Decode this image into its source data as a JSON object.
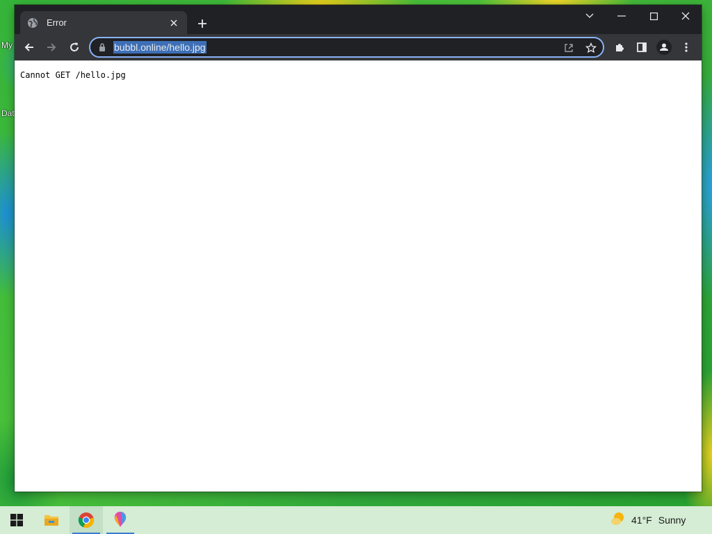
{
  "desktop": {
    "icon_label_1": "My",
    "icon_label_2": "Dat"
  },
  "browser": {
    "tab": {
      "title": "Error",
      "favicon": "globe-icon"
    },
    "new_tab_icon": "plus-icon",
    "window_controls": [
      "chevron-down-icon",
      "minimize-icon",
      "maximize-icon",
      "close-icon"
    ],
    "toolbar": {
      "back_icon": "arrow-left-icon",
      "forward_icon": "arrow-right-icon",
      "reload_icon": "reload-icon",
      "url": "bubbl.online/hello.jpg",
      "omnibox_icons": [
        "share-icon",
        "star-icon"
      ],
      "right_icons": [
        "extensions-icon",
        "side-panel-icon",
        "profile-icon",
        "more-icon"
      ]
    },
    "page": {
      "body_text": "Cannot GET /hello.jpg"
    }
  },
  "taskbar": {
    "items": [
      "windows-start-icon",
      "file-explorer-icon",
      "chrome-icon",
      "paint-icon"
    ],
    "active_item": "chrome-icon",
    "weather": {
      "temperature": "41°F",
      "condition": "Sunny"
    }
  },
  "colors": {
    "titlebar": "#202124",
    "toolbar": "#35363a",
    "omnibox_border": "#8ab4f8",
    "url_selection": "#3d6fb6",
    "taskbar": "#d5ecd5"
  }
}
